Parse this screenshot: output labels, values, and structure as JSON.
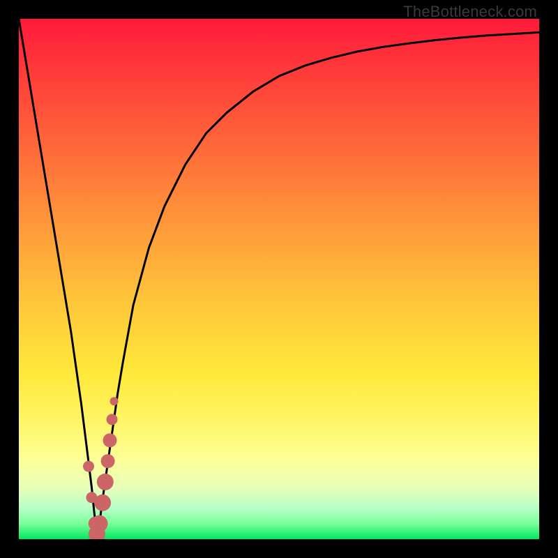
{
  "watermark": "TheBottleneck.com",
  "colors": {
    "frame": "#000000",
    "curve": "#000000",
    "dot": "#cc6666"
  },
  "chart_data": {
    "type": "line",
    "title": "",
    "xlabel": "",
    "ylabel": "",
    "xlim": [
      0,
      100
    ],
    "ylim": [
      0,
      100
    ],
    "grid": false,
    "legend": false,
    "series": [
      {
        "name": "bottleneck-curve",
        "x": [
          0,
          2,
          4,
          6,
          8,
          10,
          12,
          13,
          14,
          14.5,
          15,
          15.5,
          16,
          17,
          18,
          19,
          20,
          22,
          25,
          28,
          32,
          36,
          40,
          45,
          50,
          55,
          60,
          65,
          70,
          75,
          80,
          85,
          90,
          95,
          100
        ],
        "y": [
          100,
          88,
          76,
          64,
          52,
          40,
          26,
          18,
          10,
          5,
          1,
          3,
          7,
          14,
          21,
          28,
          34,
          45,
          56,
          64,
          72,
          78,
          82,
          86,
          89,
          91,
          92.5,
          93.7,
          94.6,
          95.3,
          95.9,
          96.4,
          96.8,
          97.1,
          97.4
        ]
      },
      {
        "name": "highlight-dots",
        "x": [
          13.4,
          14.0,
          14.7,
          15.0,
          15.5,
          16.1,
          16.6,
          17.1,
          17.5,
          17.9,
          18.3
        ],
        "y": [
          14.0,
          8.0,
          3.0,
          1.0,
          3.0,
          7.0,
          11.0,
          15.0,
          19.0,
          23.0,
          26.5
        ],
        "r": [
          8,
          8,
          10,
          12,
          12,
          12,
          12,
          10,
          10,
          8,
          6
        ]
      }
    ]
  }
}
